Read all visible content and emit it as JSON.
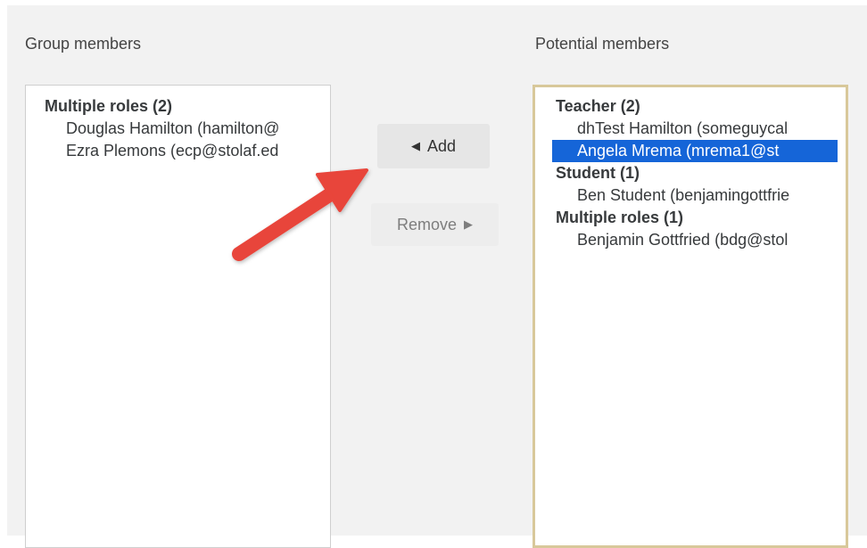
{
  "group_members": {
    "label": "Group members",
    "groups": [
      {
        "label": "Multiple roles (2)",
        "options": [
          "Douglas Hamilton (hamilton@",
          "Ezra Plemons (ecp@stolaf.ed"
        ]
      }
    ]
  },
  "potential_members": {
    "label": "Potential members",
    "selected_option": "Angela Mrema (mrema1@st",
    "groups": [
      {
        "label": "Teacher (2)",
        "options": [
          "dhTest Hamilton (someguycal",
          "Angela Mrema (mrema1@st"
        ]
      },
      {
        "label": "Student (1)",
        "options": [
          "Ben Student (benjamingottfrie"
        ]
      },
      {
        "label": "Multiple roles (1)",
        "options": [
          "Benjamin Gottfried (bdg@stol"
        ]
      }
    ]
  },
  "buttons": {
    "add_label": "Add",
    "add_icon": "left-triangle-icon",
    "remove_label": "Remove",
    "remove_icon": "right-triangle-icon"
  },
  "annotation": {
    "icon": "red-arrow-annotation",
    "color": "#e8453a"
  },
  "colors": {
    "selection": "#1565d8",
    "focus_border": "#d8c89a",
    "background": "#f2f2f2"
  }
}
